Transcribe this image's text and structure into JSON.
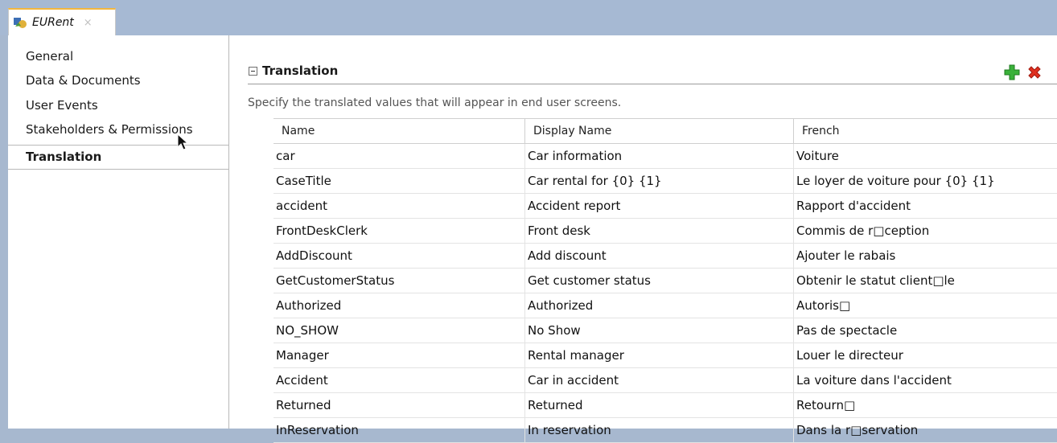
{
  "window": {
    "tab_title": "EURent",
    "tab_close": "×"
  },
  "sidebar": {
    "items": [
      {
        "label": "General"
      },
      {
        "label": "Data & Documents"
      },
      {
        "label": "User Events"
      },
      {
        "label": "Stakeholders & Permissions"
      },
      {
        "label": "Translation",
        "selected": true
      }
    ]
  },
  "main": {
    "section_title": "Translation",
    "description": "Specify the translated values that will appear in end user screens.",
    "table": {
      "columns": [
        "Name",
        "Display Name",
        "French"
      ],
      "rows": [
        [
          "car",
          "Car information",
          "Voiture"
        ],
        [
          "CaseTitle",
          "Car rental for {0} {1}",
          "Le loyer de voiture pour {0} {1}"
        ],
        [
          "accident",
          "Accident report",
          "Rapport d'accident"
        ],
        [
          "FrontDeskClerk",
          "Front desk",
          "Commis de r□ception"
        ],
        [
          "AddDiscount",
          "Add discount",
          "Ajouter le rabais"
        ],
        [
          "GetCustomerStatus",
          "Get customer status",
          "Obtenir le statut client□le"
        ],
        [
          "Authorized",
          "Authorized",
          "Autoris□"
        ],
        [
          "NO_SHOW",
          "No Show",
          "Pas de spectacle"
        ],
        [
          "Manager",
          "Rental manager",
          "Louer le directeur"
        ],
        [
          "Accident",
          "Car in accident",
          "La voiture dans l'accident"
        ],
        [
          "Returned",
          "Returned",
          "Retourn□"
        ],
        [
          "InReservation",
          "In reservation",
          "Dans la r□servation"
        ]
      ]
    }
  },
  "icons": {
    "app_icon": "app-icon",
    "add": "plus-icon",
    "delete": "x-icon",
    "collapse": "minus-box-icon",
    "cursor": "mouse-pointer-icon"
  },
  "colors": {
    "tabbar": "#a6b9d3",
    "tab_accent": "#f3b73f",
    "add_green": "#2fa52f",
    "delete_red": "#d8261f"
  }
}
